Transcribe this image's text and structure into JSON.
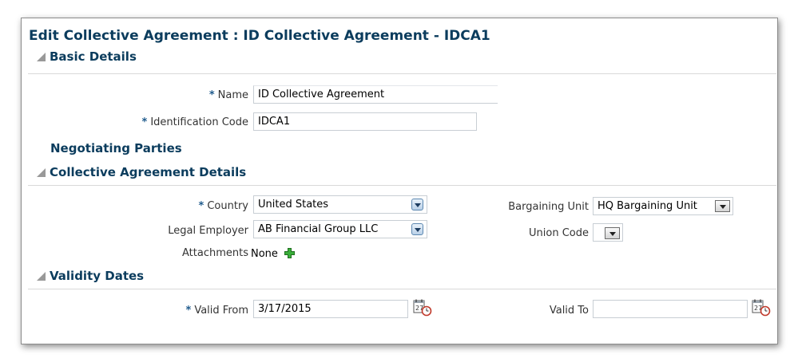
{
  "page": {
    "title": "Edit Collective Agreement : ID Collective Agreement - IDCA1"
  },
  "sections": {
    "basic_details": "Basic Details",
    "negotiating_parties": "Negotiating Parties",
    "collective_agreement_details": "Collective Agreement Details",
    "validity_dates": "Validity Dates"
  },
  "basic": {
    "name_label": "Name",
    "name_value": "ID Collective Agreement",
    "id_code_label": "Identification Code",
    "id_code_value": "IDCA1"
  },
  "details": {
    "country_label": "Country",
    "country_value": "United States",
    "legal_employer_label": "Legal Employer",
    "legal_employer_value": "AB Financial Group LLC",
    "attachments_label": "Attachments",
    "attachments_value": "None",
    "bargaining_unit_label": "Bargaining Unit",
    "bargaining_unit_value": "HQ Bargaining Unit",
    "union_code_label": "Union Code",
    "union_code_value": ""
  },
  "validity": {
    "valid_from_label": "Valid From",
    "valid_from_value": "3/17/2015",
    "valid_to_label": "Valid To",
    "valid_to_value": ""
  },
  "required_marker": "*",
  "icons": {
    "expanded": "triangle-expanded-icon",
    "collapsed": "triangle-collapsed-icon",
    "add": "plus-icon",
    "calendar": "calendar-icon",
    "dropdown": "chevron-down-icon"
  },
  "colors": {
    "title": "#0b3c5d",
    "required": "#1e5a8c",
    "add_icon": "#2e9e2e"
  }
}
